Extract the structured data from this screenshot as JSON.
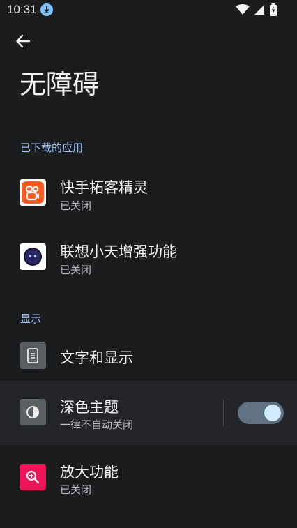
{
  "status_bar": {
    "time": "10:31",
    "icons": [
      "download-icon",
      "wifi-icon",
      "signal-icon",
      "battery-charging-icon"
    ]
  },
  "header": {
    "back_icon": "arrow-left-icon",
    "title": "无障碍"
  },
  "sections": {
    "downloaded": {
      "title": "已下载的应用",
      "items": [
        {
          "title": "快手拓客精灵",
          "subtitle": "已关闭",
          "icon": "kuaishou-app-icon"
        },
        {
          "title": "联想小天增强功能",
          "subtitle": "已关闭",
          "icon": "lenovo-xiaotian-app-icon"
        }
      ]
    },
    "display": {
      "title": "显示",
      "items": [
        {
          "title": "文字和显示",
          "icon": "text-display-icon"
        },
        {
          "title": "深色主题",
          "subtitle": "一律不自动关闭",
          "icon": "dark-theme-icon",
          "toggle_on": true
        },
        {
          "title": "放大功能",
          "subtitle": "已关闭",
          "icon": "magnification-icon"
        }
      ]
    }
  },
  "colors": {
    "background": "#1b1c1e",
    "accent": "#9ec7ff",
    "kuaishou_orange": "#ff5a1f",
    "magnify_pink": "#f0145a",
    "toggle_track": "#5f7183",
    "toggle_knob": "#d4ecff"
  }
}
